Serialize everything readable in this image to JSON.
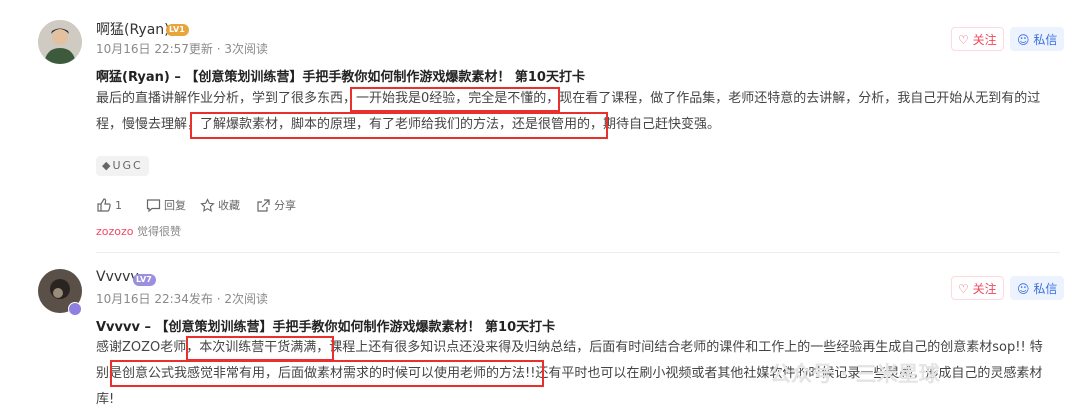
{
  "posts": [
    {
      "author": "啊猛(Ryan)",
      "level": "LV1",
      "level_color": "#e8a53c",
      "time": "10月16日 22:57更新",
      "reads": "3次阅读",
      "follow_label": "关注",
      "message_label": "私信",
      "title": "啊猛(Ryan) – 【创意策划训练营】手把手教你如何制作游戏爆款素材！ 第10天打卡",
      "body_lines": [
        "最后的直播讲解作业分析，学到了很多东西，一开始我是0经验，完全是不懂的，现在看了课程，做了作品集，老师还特意的去讲解，分析，我自己开始从无到有的过",
        "程，慢慢去理解，了解爆款素材，脚本的原理，有了老师给我们的方法，还是很管用的，期待自己赶快变强。"
      ],
      "tag": "UGC",
      "like_count": "1",
      "reply_label": "回复",
      "collect_label": "收藏",
      "share_label": "分享",
      "liker_name": "zozozo",
      "liker_text": "觉得很赞"
    },
    {
      "author": "Vvvvv",
      "level": "LV7",
      "level_color": "#9b8fe0",
      "time": "10月16日 22:34发布",
      "reads": "2次阅读",
      "follow_label": "关注",
      "message_label": "私信",
      "title": "Vvvvv – 【创意策划训练营】手把手教你如何制作游戏爆款素材！ 第10天打卡",
      "body_lines": [
        "感谢ZOZO老师，本次训练营干货满满，课程上还有很多知识点还没来得及归纳总结，后面有时间结合老师的课件和工作上的一些经验再生成自己的创意素材sop!! 特",
        "别是创意公式我感觉非常有用，后面做素材需求的时候可以使用老师的方法!!还有平时也可以在刷小视频或者其他社媒软件的时候记录一些灵感，形成自己的灵感素材",
        "库!"
      ]
    }
  ],
  "watermark": "公众号 · 三米星球",
  "accent": "#f0485c",
  "highlight_color": "#e8302c"
}
